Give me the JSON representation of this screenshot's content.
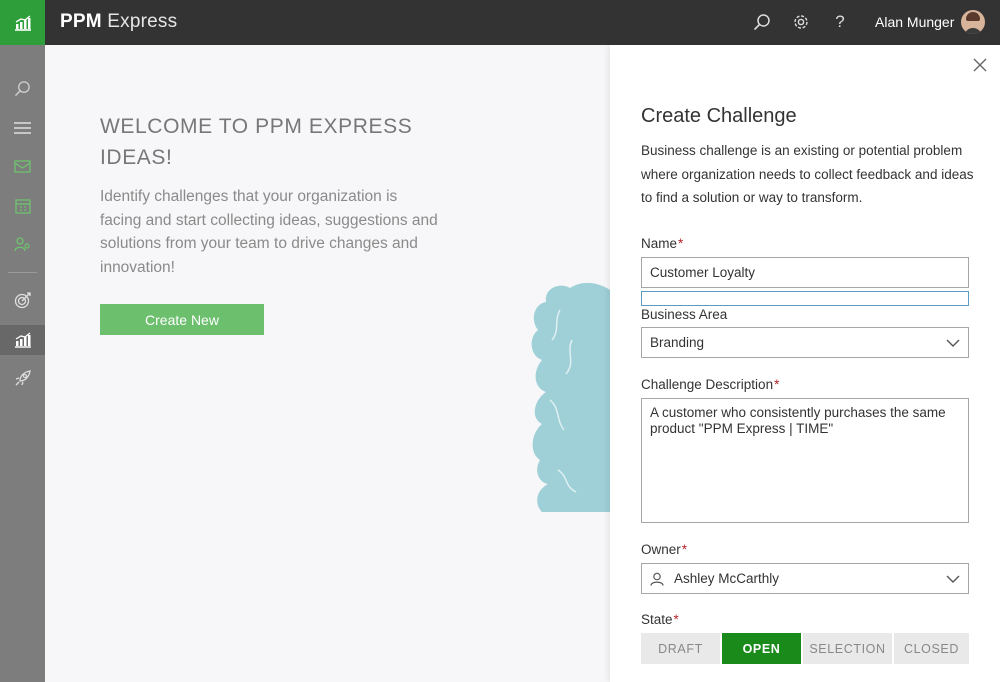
{
  "app": {
    "brand_bold": "PPM",
    "brand_rest": " Express"
  },
  "topbar": {
    "icons": [
      "search-icon",
      "gear-icon",
      "help-icon"
    ],
    "help_glyph": "?",
    "user_name": "Alan Munger"
  },
  "rail": {
    "items": [
      "search-icon",
      "menu-icon",
      "envelope-icon",
      "calendar-icon",
      "users-icon",
      "target-icon",
      "chart-icon",
      "rocket-icon"
    ],
    "active": "chart-icon"
  },
  "welcome": {
    "title": "WELCOME TO PPM EXPRESS IDEAS!",
    "text": "Identify challenges that your organization is facing and start collecting ideas, suggestions and solutions from your team to drive changes and innovation!",
    "create_button": "Create New"
  },
  "panel": {
    "title": "Create Challenge",
    "description": "Business challenge is an existing or potential problem where organization needs to collect feedback and ideas to find a solution or way to transform.",
    "name_label": "Name",
    "name_value": "Customer Loyalty",
    "business_area_label": "Business Area",
    "business_area_value": "Branding",
    "description_label": "Challenge Description",
    "description_value": "A customer who consistently purchases the same product \"PPM Express | TIME\"",
    "owner_label": "Owner",
    "owner_value": "Ashley McCarthly",
    "state_label": "State",
    "required_mark": "*",
    "states": [
      {
        "label": "DRAFT",
        "selected": false
      },
      {
        "label": "OPEN",
        "selected": true
      },
      {
        "label": "SELECTION",
        "selected": false
      },
      {
        "label": "CLOSED",
        "selected": false
      }
    ]
  },
  "colors": {
    "accent_green": "#2e9e3a",
    "state_selected": "#1a8b1a",
    "create_button": "#6cbf6d",
    "topbar": "#333333",
    "rail": "#7d7d7d",
    "required": "#b3262d",
    "tree": "#9fd0d8"
  }
}
